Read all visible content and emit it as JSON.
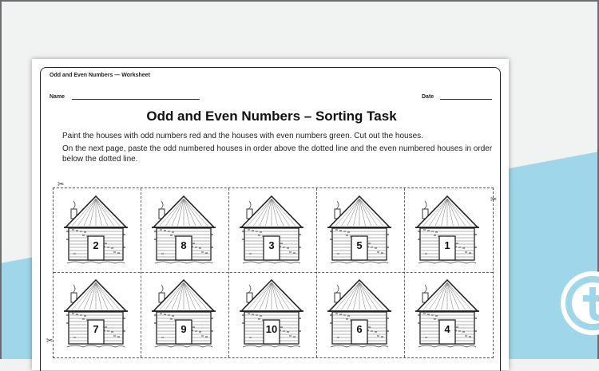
{
  "worksheet": {
    "header_title": "Odd and Even Numbers — Worksheet",
    "name_label": "Name",
    "date_label": "Date",
    "title": "Odd and Even Numbers – Sorting Task",
    "instructions": [
      "Paint the houses with odd numbers red and the houses with even numbers green. Cut out the houses.",
      "On the next page, paste the odd numbered houses in order above the dotted line and the even numbered houses in order below the dotted line."
    ]
  },
  "houses": {
    "row1": [
      "2",
      "8",
      "3",
      "5",
      "1"
    ],
    "row2": [
      "7",
      "9",
      "10",
      "6",
      "4"
    ]
  },
  "icons": {
    "scissors": "scissors-icon",
    "logo": "twinkl-logo-icon"
  },
  "colors": {
    "background": "#f1f2f2",
    "accent_band": "#9fd6e9"
  }
}
